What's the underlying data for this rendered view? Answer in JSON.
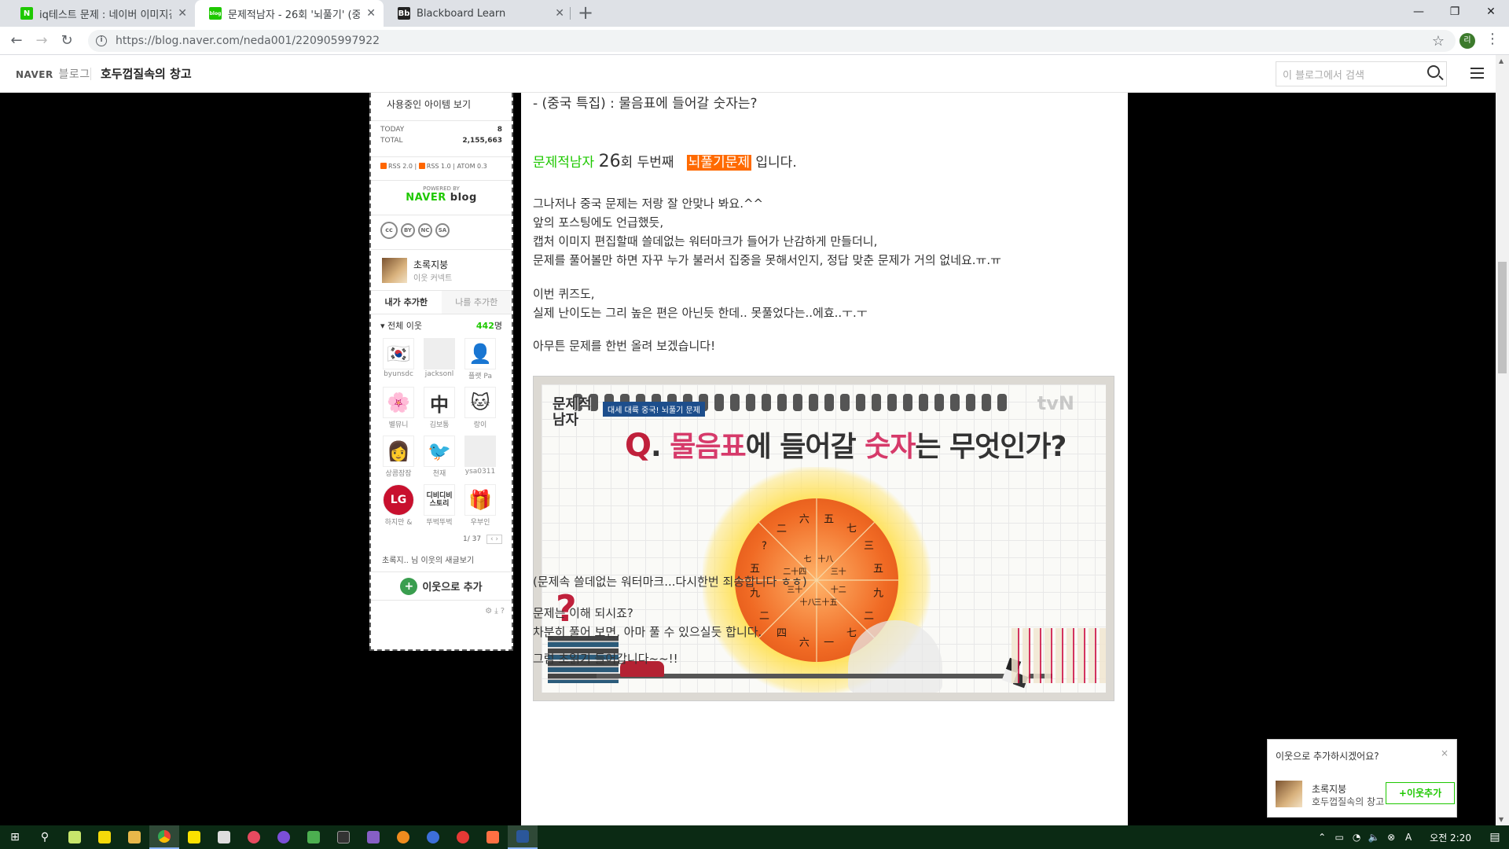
{
  "browser": {
    "tabs": [
      {
        "title": "iq테스트 문제 : 네이버 이미지검",
        "favicon_label": "N",
        "favicon_color": "#1ec800",
        "active": false
      },
      {
        "title": "문제적남자 - 26회 '뇌풀기' (중국",
        "favicon_label": "blog",
        "favicon_color": "#1ec800",
        "active": true
      },
      {
        "title": "Blackboard Learn",
        "favicon_label": "Bb",
        "favicon_color": "#222222",
        "active": false
      }
    ],
    "new_tab_icon": "+",
    "url": "https://blog.naver.com/neda001/220905997922",
    "profile_initial": "리"
  },
  "header": {
    "logo": "NAVER",
    "logo_sub": "블로그",
    "blog_title": "호두껍질속의 창고",
    "search_placeholder": "이 블로그에서 검색"
  },
  "sidebar": {
    "items_link": "사용중인 아이템 보기",
    "stats": {
      "today_label": "TODAY",
      "today_value": "8",
      "total_label": "TOTAL",
      "total_value": "2,155,663"
    },
    "rss": {
      "a": "RSS 2.0",
      "b": "RSS 1.0",
      "c": "ATOM 0.3"
    },
    "powered_by": "POWERED BY",
    "powered_logo_a": "NAVER",
    "powered_logo_b": " blog",
    "cc_labels": [
      "cc",
      "BY",
      "NC",
      "SA"
    ],
    "owner_name": "초록지붕",
    "owner_sub": "이웃 커넥트",
    "tabs": [
      "내가 추가한",
      "나를 추가한"
    ],
    "total_neighbors_label": "전체 이웃",
    "total_neighbors_count": "442",
    "total_neighbors_unit": "명",
    "neighbors": [
      {
        "name": "byunsdc",
        "glyph": "🇰🇷"
      },
      {
        "name": "jacksonl",
        "glyph": ""
      },
      {
        "name": "플랫 Pa",
        "glyph": "👤"
      },
      {
        "name": "별뮤니",
        "glyph": "🌸"
      },
      {
        "name": "김보통",
        "glyph": "中"
      },
      {
        "name": "랑이",
        "glyph": "🐱"
      },
      {
        "name": "상콤잠잠",
        "glyph": "👩"
      },
      {
        "name": "천재",
        "glyph": "🐦"
      },
      {
        "name": "ysa0311",
        "glyph": ""
      },
      {
        "name": "하지만 &",
        "glyph": "LG"
      },
      {
        "name": "뚜벅뚜벅",
        "glyph": "디비디비 스토리"
      },
      {
        "name": "우부인",
        "glyph": "🎁"
      }
    ],
    "page_indicator": "1/ 37",
    "new_posts": "초록지.. 님 이웃의 새글보기",
    "add_neighbor": "이웃으로 추가"
  },
  "post": {
    "line1": "- (중국 특집) : 물음표에 들어갈 숫자는?",
    "line2_green": "문제적남자",
    "line2_num": "26",
    "line2_mid": "회 두번째",
    "line2_hl": "뇌풀기문제",
    "line2_end": " 입니다.",
    "para1": [
      "그나저나 중국 문제는 저랑 잘 안맞나 봐요.^^",
      "앞의 포스팅에도 언급했듯,",
      "캡처 이미지 편집할때 쓸데없는 워터마크가 들어가 난감하게 만들더니,",
      "문제를 풀어볼만 하면 자꾸 누가 불러서 집중을 못해서인지, 정답 맞춘 문제가 거의 없네요.ㅠ.ㅠ"
    ],
    "para2": [
      "이번 퀴즈도,",
      "실제 난이도는 그리 높은 편은 아닌듯 한데.. 못풀었다는..에효..ㅜ.ㅜ"
    ],
    "para3": "아무튼 문제를 한번 올려 보겠습니다!",
    "quiz": {
      "show_logo": "문제적\n남자",
      "tag": "대세 대륙 중국! 뇌풀기 문제",
      "watermark": "tvN",
      "q_letter": "Q",
      "q_text_a": ". ",
      "q_text_b": "물음표",
      "q_text_c": "에 들어갈 ",
      "q_text_d": "숫자",
      "q_text_e": "는 무엇인가?",
      "outer_chars": [
        "五",
        "七",
        "三",
        "五",
        "九",
        "二",
        "七",
        "一",
        "六",
        "四",
        "二",
        "九",
        "五",
        "?",
        "二",
        "六"
      ],
      "inner_chars": [
        "十八",
        "三十",
        "十二",
        "三十五",
        "十八",
        "三十",
        "二十四",
        "七"
      ],
      "big_q": "?"
    },
    "caption": "(문제속 쓸데없는 워터마크...다시한번 죄송합니다 ㅎㅎ)",
    "para4": [
      "문제는 이해 되시죠?",
      "차분히 풀어 보면, 아마 풀 수 있으실듯 합니다."
    ],
    "para5": "그럼 초읽기 들어갑니다~~!!"
  },
  "popup": {
    "title": "이웃으로 추가하시겠어요?",
    "close": "×",
    "name": "초록지붕",
    "blog": "호두껍질속의 창고",
    "button": "+이웃추가"
  },
  "taskbar": {
    "clock": "오전 2:20",
    "ime": "A"
  }
}
